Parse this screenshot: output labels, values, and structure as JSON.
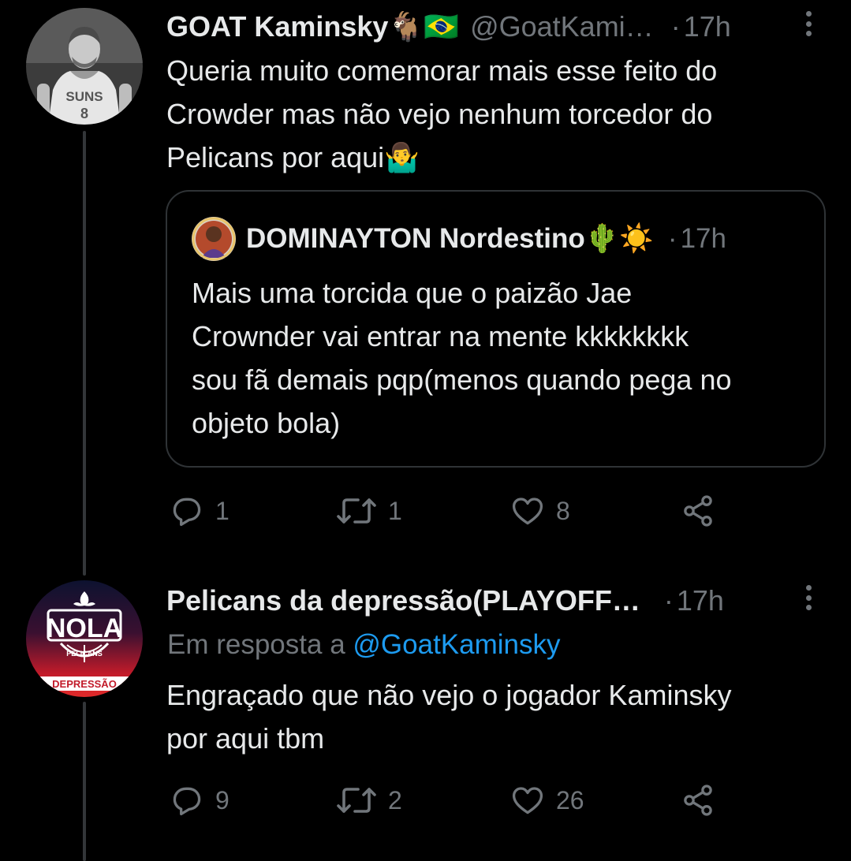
{
  "tweet1": {
    "name": "GOAT Kaminsky🐐🇧🇷",
    "handle": "@GoatKami…",
    "dot": "·",
    "time": "17h",
    "text": "Queria muito comemorar mais esse feito do\nCrowder mas não vejo nenhum torcedor do\nPelicans por aqui🤷‍♂️",
    "avatar_jersey": "SUNS\n8",
    "quote": {
      "name": "DOMINAYTON Nordestino🌵☀️",
      "dot": "·",
      "time": "17h",
      "text": "Mais uma torcida que o paizão Jae\nCrownder vai entrar na mente kkkkkkkk\nsou fã demais pqp(menos quando pega no\nobjeto bola)"
    },
    "actions": {
      "replies": "1",
      "retweets": "1",
      "likes": "8"
    }
  },
  "tweet2": {
    "name": "Pelicans da depressão(PLAYOFF…",
    "dot": "·",
    "time": "17h",
    "reply_prefix": "Em resposta a ",
    "reply_handle": "@GoatKaminsky",
    "text": "Engraçado que não vejo o jogador Kaminsky\npor aqui tbm",
    "avatar_logo": "NOLA",
    "avatar_sub": "PELICANS",
    "avatar_band": "DEPRESSÃO",
    "actions": {
      "replies": "9",
      "retweets": "2",
      "likes": "26"
    }
  },
  "icons": [
    "reply-icon",
    "retweet-icon",
    "like-icon",
    "share-icon",
    "more-icon"
  ],
  "colors": {
    "background": "#000000",
    "text": "#e7e9ea",
    "muted": "#71767b",
    "link": "#1d9bf0",
    "border": "#2f3336"
  }
}
